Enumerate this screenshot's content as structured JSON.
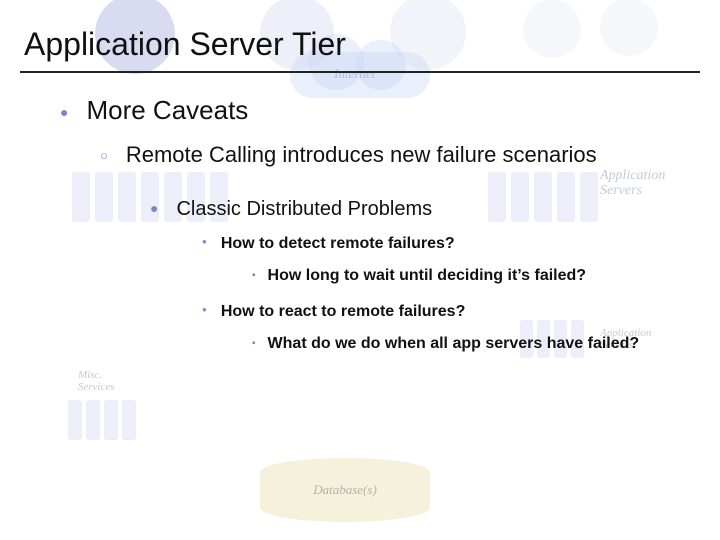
{
  "slide": {
    "title": "Application Server Tier",
    "bullets": {
      "l1": "More Caveats",
      "l2": "Remote Calling introduces new failure scenarios",
      "l3": "Classic Distributed Problems",
      "l4a": "How to detect remote failures?",
      "l5a": "How long to wait until deciding it’s failed?",
      "l4b": "How to react to remote failures?",
      "l5b": "What do we do when all app servers have failed?"
    }
  },
  "background_labels": {
    "internet": "Internet",
    "app_servers_right": "Application\nServers",
    "app_servers_right_small": "Application\nServers",
    "misc_left": "Misc.\nServices",
    "databases": "Database(s)"
  }
}
